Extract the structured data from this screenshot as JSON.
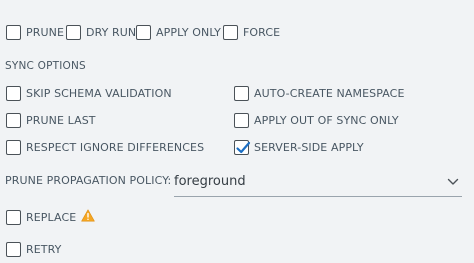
{
  "top_options": [
    {
      "label": "PRUNE",
      "checked": false
    },
    {
      "label": "DRY RUN",
      "checked": false
    },
    {
      "label": "APPLY ONLY",
      "checked": false
    },
    {
      "label": "FORCE",
      "checked": false
    }
  ],
  "sync_options": {
    "title": "SYNC OPTIONS",
    "left": [
      {
        "label": "SKIP SCHEMA VALIDATION",
        "checked": false
      },
      {
        "label": "PRUNE LAST",
        "checked": false
      },
      {
        "label": "RESPECT IGNORE DIFFERENCES",
        "checked": false
      }
    ],
    "right": [
      {
        "label": "AUTO-CREATE NAMESPACE",
        "checked": false
      },
      {
        "label": "APPLY OUT OF SYNC ONLY",
        "checked": false
      },
      {
        "label": "SERVER-SIDE APPLY",
        "checked": true
      }
    ]
  },
  "prune_propagation": {
    "label": "PRUNE PROPAGATION POLICY:",
    "value": "foreground"
  },
  "replace": {
    "label": "REPLACE",
    "checked": false,
    "warning_icon": "warning-triangle-icon",
    "warning_color": "#f4a623"
  },
  "retry": {
    "label": "RETRY",
    "checked": false
  },
  "colors": {
    "check_accent": "#1c6fc4",
    "text": "#495763",
    "background": "#f1f3f5"
  }
}
